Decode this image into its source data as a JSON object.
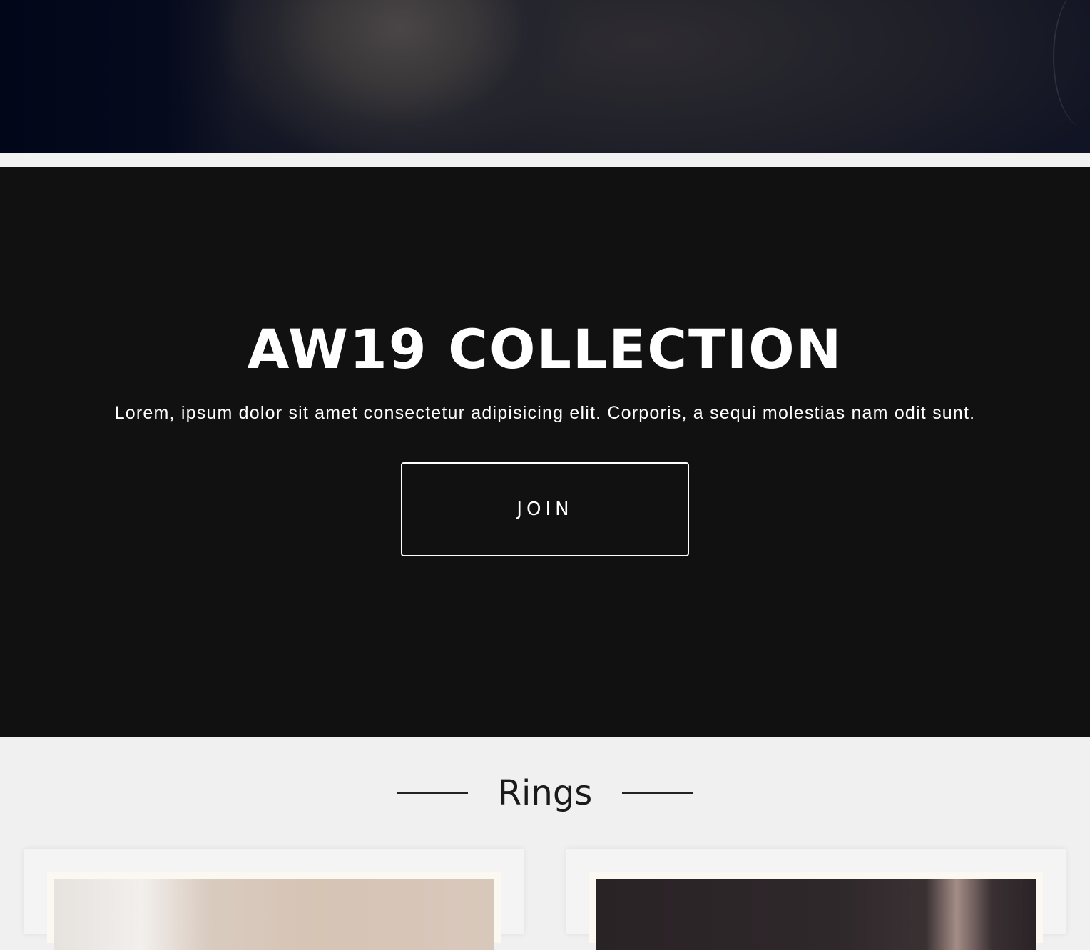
{
  "promo": {
    "title": "AW19 COLLECTION",
    "text": "Lorem, ipsum dolor sit amet consectetur adipisicing elit. Corporis, a sequi molestias nam odit sunt.",
    "button_label": "JOIN"
  },
  "rings": {
    "heading": "Rings"
  },
  "colors": {
    "promo_background": "#111111",
    "page_background": "#f0f0f0",
    "text_light": "#ffffff"
  }
}
